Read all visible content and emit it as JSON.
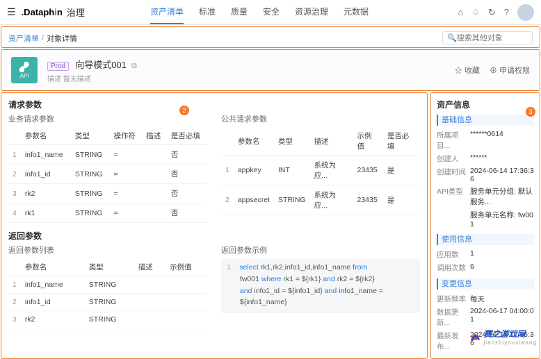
{
  "top": {
    "logo1": ".Dataph",
    "logo2": "i",
    "logo3": "n",
    "product": "治理",
    "nav": [
      "资产清单",
      "标准",
      "质量",
      "安全",
      "资源治理",
      "元数据"
    ],
    "active": 0
  },
  "search": {
    "placeholder": "搜索其他对象"
  },
  "crumb": {
    "a": "资产清单",
    "b": "对象详情"
  },
  "hero": {
    "prod": "Prod",
    "name": "向导模式001",
    "desc_k": "描述",
    "desc_v": "暂无描述",
    "fav": "收藏",
    "perm": "申请权限",
    "api": "API"
  },
  "req": {
    "title": "请求参数",
    "biz": "业务请求参数",
    "pub": "公共请求参数",
    "cols": [
      "参数名",
      "类型",
      "操作符",
      "描述",
      "是否必填"
    ],
    "cols2": [
      "参数名",
      "类型",
      "描述",
      "示例值",
      "是否必填"
    ],
    "biz_rows": [
      [
        "info1_name",
        "STRING",
        "=",
        "",
        "否"
      ],
      [
        "info1_id",
        "STRING",
        "=",
        "",
        "否"
      ],
      [
        "rk2",
        "STRING",
        "=",
        "",
        "否"
      ],
      [
        "rk1",
        "STRING",
        "=",
        "",
        "否"
      ]
    ],
    "pub_rows": [
      [
        "appkey",
        "INT",
        "系统为应...",
        "23435",
        "是"
      ],
      [
        "appsecret",
        "STRING",
        "系统为应...",
        "23435",
        "是"
      ]
    ]
  },
  "ret": {
    "title": "返回参数",
    "list": "返回参数列表",
    "sample": "返回参数示例",
    "cols": [
      "参数名",
      "类型",
      "描述",
      "示例值"
    ],
    "rows": [
      [
        "info1_name",
        "STRING",
        "",
        ""
      ],
      [
        "info1_id",
        "STRING",
        "",
        ""
      ],
      [
        "rk2",
        "STRING",
        "",
        ""
      ]
    ],
    "code": {
      "l1a": "select",
      "l1b": " rk1,rk2,info1_id,info1_name ",
      "l1c": "from",
      "l2a": "fw001 ",
      "l2b": "where",
      "l2c": " rk1 = ${rk1}  ",
      "l2d": "and",
      "l2e": " rk2 = ${rk2}",
      "l3a": "and",
      "l3b": " info1_id = ${info1_id} ",
      "l3c": "and",
      "l3d": " info1_name = ",
      "l4": "${info1_name}"
    }
  },
  "info": {
    "title": "资产信息",
    "g1": "基础信息",
    "r1": [
      [
        "所属项目...",
        "******0614"
      ],
      [
        "创建人",
        "******"
      ],
      [
        "创建时间",
        "2024-06-14 17:36:36"
      ],
      [
        "API类型",
        "服务单元分组: 默认服务..."
      ],
      [
        "",
        "服务单元名称: fw001"
      ]
    ],
    "g2": "使用信息",
    "r2": [
      [
        "应用数",
        "1"
      ],
      [
        "调用次数",
        "6"
      ]
    ],
    "g3": "变更信息",
    "r3": [
      [
        "更新频率",
        "每天"
      ],
      [
        "数据更新...",
        "2024-06-17 04:00:01"
      ],
      [
        "最新发布...",
        "2024-06-14 17:36:36"
      ]
    ]
  },
  "wm": {
    "t": "赛之游戏网",
    "s": "jianzhiyouxiwang"
  }
}
